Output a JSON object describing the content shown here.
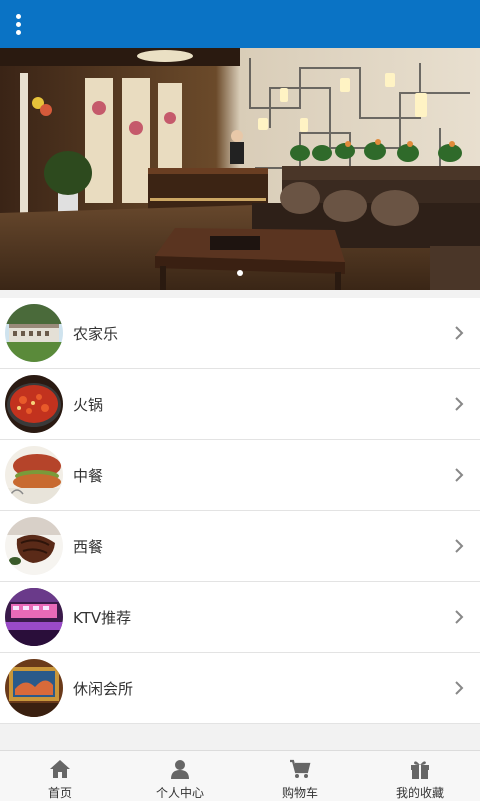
{
  "header": {
    "menu_icon": "more-vertical-icon",
    "bg_color": "#0a73c5"
  },
  "banner": {
    "slides": 1,
    "active_index": 0,
    "image": "hotel lobby with sofa and reception desk"
  },
  "categories": [
    {
      "label": "农家乐",
      "thumb": "farmhouse"
    },
    {
      "label": "火锅",
      "thumb": "hotpot"
    },
    {
      "label": "中餐",
      "thumb": "chinese-food"
    },
    {
      "label": "西餐",
      "thumb": "steak"
    },
    {
      "label": "KTV推荐",
      "thumb": "ktv"
    },
    {
      "label": "休闲会所",
      "thumb": "club"
    }
  ],
  "tabbar": [
    {
      "label": "首页",
      "icon": "home-icon"
    },
    {
      "label": "个人中心",
      "icon": "user-icon"
    },
    {
      "label": "购物车",
      "icon": "cart-icon"
    },
    {
      "label": "我的收藏",
      "icon": "gift-icon"
    }
  ]
}
